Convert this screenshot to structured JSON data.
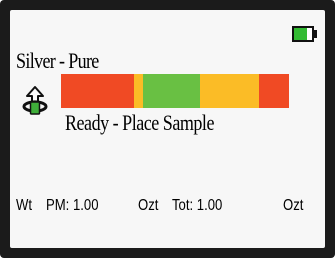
{
  "screen": {
    "alloy_name": "Silver - Pure",
    "status_text": "Ready - Place Sample",
    "battery_level": 0.72,
    "spectrum": {
      "segments": [
        {
          "color": "#f04a24",
          "weight": 0.32
        },
        {
          "color": "#fbbc26",
          "weight": 0.04
        },
        {
          "color": "#69c043",
          "weight": 0.25
        },
        {
          "color": "#fbbc26",
          "weight": 0.26
        },
        {
          "color": "#f04a24",
          "weight": 0.13
        }
      ]
    },
    "footer": {
      "wt_label": "Wt",
      "pm_label": "PM: 1.00",
      "pm_unit": "Ozt",
      "tot_label": "Tot: 1.00",
      "tot_unit": "Ozt"
    }
  },
  "colors": {
    "screen_bg": "#f7f7f7",
    "bezel": "#1b1b1b",
    "battery_fill": "#33bb33",
    "icon_green": "#3fae3a"
  },
  "icons": {
    "battery": "battery-icon",
    "status": "rotate-arrow-icon"
  }
}
